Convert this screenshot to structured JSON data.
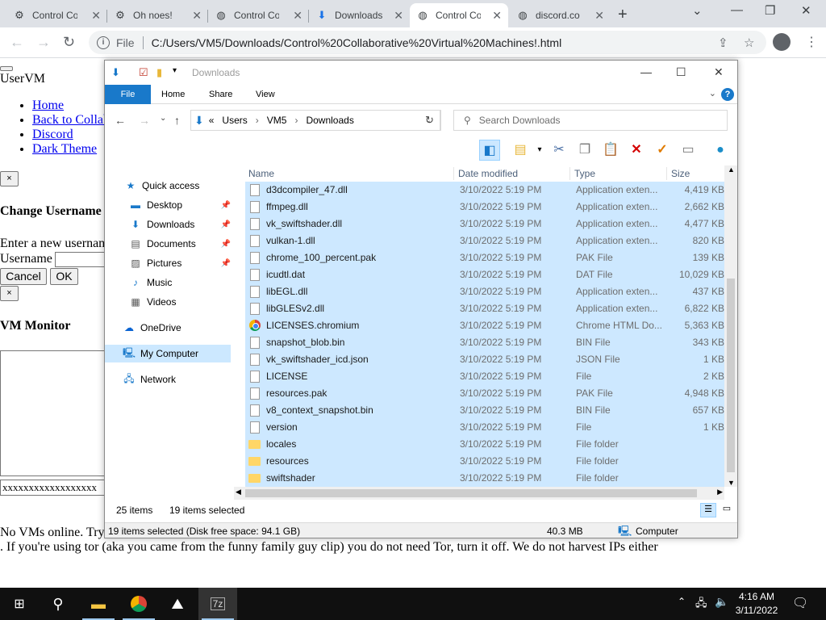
{
  "browser": {
    "tabs": [
      {
        "title": "Control Co",
        "icon": "cvm-logo-icon"
      },
      {
        "title": "Oh noes!",
        "icon": "cvm-logo-icon"
      },
      {
        "title": "Control Co",
        "icon": "globe-icon"
      },
      {
        "title": "Downloads",
        "icon": "download-icon"
      },
      {
        "title": "Control Co",
        "icon": "globe-icon",
        "active": true
      },
      {
        "title": "discord.co",
        "icon": "globe-icon"
      }
    ],
    "address": {
      "scheme_label": "File",
      "url": "C:/Users/VM5/Downloads/Control%20Collaborative%20Virtual%20Machines!.html"
    }
  },
  "page": {
    "heading_user": "UserVM",
    "nav_links": [
      "Home",
      "Back to Collab",
      "Discord",
      "Dark Theme"
    ],
    "close_glyph": "×",
    "change_username_title": "Change Username",
    "enter_prompt": "Enter a new usernan",
    "username_label": "Username",
    "cancel_label": "Cancel",
    "ok_label": "OK",
    "vm_monitor_title": "VM Monitor",
    "vm_input_value": "xxxxxxxxxxxxxxxxxx",
    "no_vms_text": "No VMs online. Try",
    "tor_text": ". If you're using tor (aka you came from the funny family guy clip) you do not need Tor, turn it off. We do not harvest IPs either"
  },
  "explorer": {
    "title": "Downloads",
    "ribbon_tabs": [
      "File",
      "Home",
      "Share",
      "View"
    ],
    "help": "?",
    "breadcrumb": [
      "«",
      "Users",
      "VM5",
      "Downloads"
    ],
    "search_placeholder": "Search Downloads",
    "sidebar": [
      {
        "label": "Quick access",
        "icon": "star-icon"
      },
      {
        "label": "Desktop",
        "icon": "desktop-icon",
        "pinned": true
      },
      {
        "label": "Downloads",
        "icon": "download-icon",
        "pinned": true
      },
      {
        "label": "Documents",
        "icon": "documents-icon",
        "pinned": true
      },
      {
        "label": "Pictures",
        "icon": "pictures-icon",
        "pinned": true
      },
      {
        "label": "Music",
        "icon": "music-icon"
      },
      {
        "label": "Videos",
        "icon": "videos-icon"
      },
      {
        "label": "OneDrive",
        "icon": "cloud-icon"
      },
      {
        "label": "My Computer",
        "icon": "computer-icon",
        "selected": true
      },
      {
        "label": "Network",
        "icon": "network-icon"
      }
    ],
    "columns": [
      "Name",
      "Date modified",
      "Type",
      "Size"
    ],
    "files": [
      {
        "name": "d3dcompiler_47.dll",
        "date": "3/10/2022 5:19 PM",
        "type": "Application exten...",
        "size": "4,419 KB",
        "kind": "file"
      },
      {
        "name": "ffmpeg.dll",
        "date": "3/10/2022 5:19 PM",
        "type": "Application exten...",
        "size": "2,662 KB",
        "kind": "file"
      },
      {
        "name": "vk_swiftshader.dll",
        "date": "3/10/2022 5:19 PM",
        "type": "Application exten...",
        "size": "4,477 KB",
        "kind": "file"
      },
      {
        "name": "vulkan-1.dll",
        "date": "3/10/2022 5:19 PM",
        "type": "Application exten...",
        "size": "820 KB",
        "kind": "file"
      },
      {
        "name": "chrome_100_percent.pak",
        "date": "3/10/2022 5:19 PM",
        "type": "PAK File",
        "size": "139 KB",
        "kind": "file"
      },
      {
        "name": "icudtl.dat",
        "date": "3/10/2022 5:19 PM",
        "type": "DAT File",
        "size": "10,029 KB",
        "kind": "file"
      },
      {
        "name": "libEGL.dll",
        "date": "3/10/2022 5:19 PM",
        "type": "Application exten...",
        "size": "437 KB",
        "kind": "file"
      },
      {
        "name": "libGLESv2.dll",
        "date": "3/10/2022 5:19 PM",
        "type": "Application exten...",
        "size": "6,822 KB",
        "kind": "file"
      },
      {
        "name": "LICENSES.chromium",
        "date": "3/10/2022 5:19 PM",
        "type": "Chrome HTML Do...",
        "size": "5,363 KB",
        "kind": "chrome"
      },
      {
        "name": "snapshot_blob.bin",
        "date": "3/10/2022 5:19 PM",
        "type": "BIN File",
        "size": "343 KB",
        "kind": "file"
      },
      {
        "name": "vk_swiftshader_icd.json",
        "date": "3/10/2022 5:19 PM",
        "type": "JSON File",
        "size": "1 KB",
        "kind": "file"
      },
      {
        "name": "LICENSE",
        "date": "3/10/2022 5:19 PM",
        "type": "File",
        "size": "2 KB",
        "kind": "file"
      },
      {
        "name": "resources.pak",
        "date": "3/10/2022 5:19 PM",
        "type": "PAK File",
        "size": "4,948 KB",
        "kind": "file"
      },
      {
        "name": "v8_context_snapshot.bin",
        "date": "3/10/2022 5:19 PM",
        "type": "BIN File",
        "size": "657 KB",
        "kind": "file"
      },
      {
        "name": "version",
        "date": "3/10/2022 5:19 PM",
        "type": "File",
        "size": "1 KB",
        "kind": "file"
      },
      {
        "name": "locales",
        "date": "3/10/2022 5:19 PM",
        "type": "File folder",
        "size": "",
        "kind": "folder"
      },
      {
        "name": "resources",
        "date": "3/10/2022 5:19 PM",
        "type": "File folder",
        "size": "",
        "kind": "folder"
      },
      {
        "name": "swiftshader",
        "date": "3/10/2022 5:19 PM",
        "type": "File folder",
        "size": "",
        "kind": "folder"
      }
    ],
    "item_count": "25 items",
    "selected_count": "19 items selected",
    "status_selected": "19 items selected (Disk free space: 94.1 GB)",
    "status_size": "40.3 MB",
    "status_location": "Computer"
  },
  "taskbar": {
    "time": "4:16 AM",
    "date": "3/11/2022"
  },
  "colors": {
    "accent": "#1979ca",
    "selection": "#cde8ff",
    "taskbar": "#101010"
  }
}
